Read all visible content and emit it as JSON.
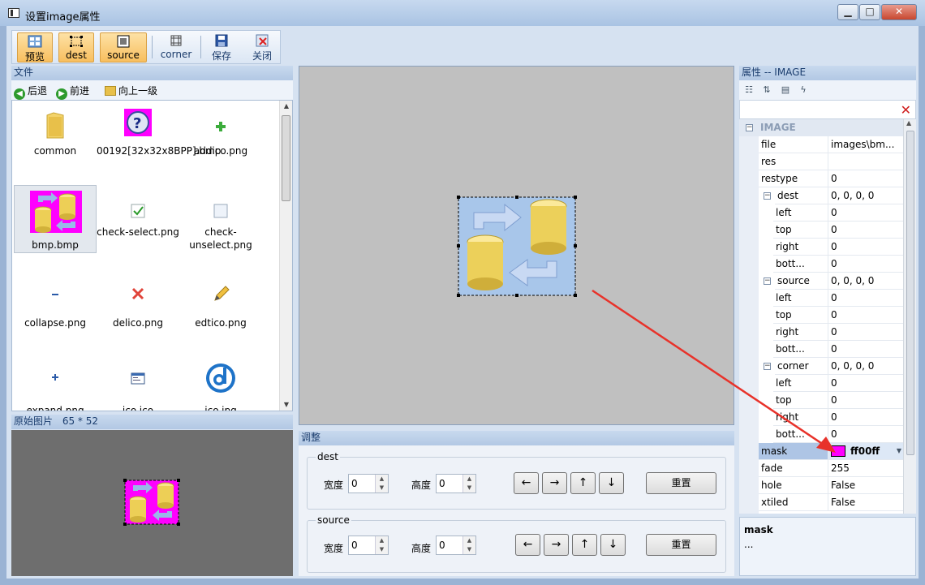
{
  "window": {
    "title": "设置image属性",
    "min": "▁",
    "max": "□",
    "close": "✕"
  },
  "toolbar": {
    "preview": "预览",
    "dest": "dest",
    "source": "source",
    "corner": "corner",
    "save": "保存",
    "close": "关闭"
  },
  "files": {
    "header": "文件",
    "back": "后退",
    "forward": "前进",
    "up": "向上一级",
    "items": [
      {
        "name": "common"
      },
      {
        "name": "00192[32x32x8BPP].bmp"
      },
      {
        "name": "addico.png"
      },
      {
        "name": "bmp.bmp"
      },
      {
        "name": "check-select.png"
      },
      {
        "name": "check-unselect.png"
      },
      {
        "name": "collapse.png"
      },
      {
        "name": "delico.png"
      },
      {
        "name": "edtico.png"
      },
      {
        "name": "expand.png"
      },
      {
        "name": "ico.ico"
      },
      {
        "name": "ico.jpg"
      }
    ]
  },
  "preview": {
    "header": "原始图片",
    "size": "65 * 52"
  },
  "adjust": {
    "header": "调整",
    "dest": {
      "title": "dest",
      "width_label": "宽度",
      "width": "0",
      "height_label": "高度",
      "height": "0",
      "reset": "重置"
    },
    "source": {
      "title": "source",
      "width_label": "宽度",
      "width": "0",
      "height_label": "高度",
      "height": "0",
      "reset": "重置"
    },
    "arrows": {
      "left": "←",
      "right": "→",
      "up": "↑",
      "down": "↓"
    }
  },
  "props": {
    "header": "属性 -- IMAGE",
    "category": "IMAGE",
    "rows": [
      {
        "name": "file",
        "value": "images\\bm..."
      },
      {
        "name": "res",
        "value": ""
      },
      {
        "name": "restype",
        "value": "0"
      },
      {
        "name": "dest",
        "value": "0, 0, 0, 0"
      },
      {
        "name": "left",
        "value": "0"
      },
      {
        "name": "top",
        "value": "0"
      },
      {
        "name": "right",
        "value": "0"
      },
      {
        "name": "bott...",
        "value": "0"
      },
      {
        "name": "source",
        "value": "0, 0, 0, 0"
      },
      {
        "name": "left",
        "value": "0"
      },
      {
        "name": "top",
        "value": "0"
      },
      {
        "name": "right",
        "value": "0"
      },
      {
        "name": "bott...",
        "value": "0"
      },
      {
        "name": "corner",
        "value": "0, 0, 0, 0"
      },
      {
        "name": "left",
        "value": "0"
      },
      {
        "name": "top",
        "value": "0"
      },
      {
        "name": "right",
        "value": "0"
      },
      {
        "name": "bott...",
        "value": "0"
      },
      {
        "name": "mask",
        "value": "ff00ff"
      },
      {
        "name": "fade",
        "value": "255"
      },
      {
        "name": "hole",
        "value": "False"
      },
      {
        "name": "xtiled",
        "value": "False"
      }
    ],
    "desc_title": "mask",
    "desc_text": "..."
  },
  "colors": {
    "mask": "#ff00ff",
    "accent_arrow": "#e8322a",
    "canvas_bg": "#c0c0c0"
  }
}
